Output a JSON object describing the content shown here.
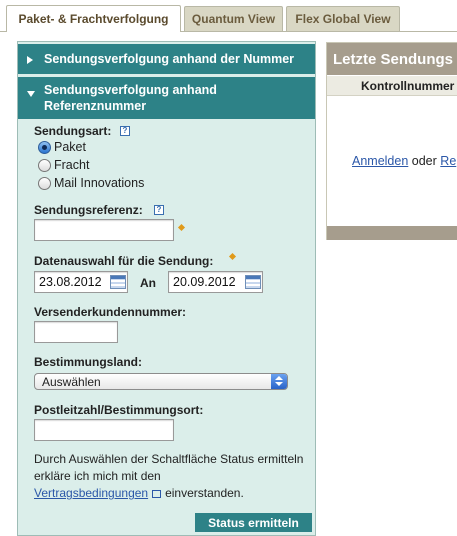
{
  "tabs": [
    {
      "label": "Paket- & Frachtverfolgung",
      "active": true
    },
    {
      "label": "Quantum View",
      "active": false
    },
    {
      "label": "Flex Global View",
      "active": false
    }
  ],
  "sections": {
    "by_number": "Sendungsverfolgung anhand der Nummer",
    "by_reference": "Sendungsverfolgung anhand Referenznummer"
  },
  "form": {
    "shipment_type": {
      "label": "Sendungsart:",
      "options": [
        "Paket",
        "Fracht",
        "Mail Innovations"
      ],
      "selected": "Paket"
    },
    "reference": {
      "label": "Sendungsreferenz:",
      "value": ""
    },
    "date_range": {
      "label": "Datenauswahl für die Sendung:",
      "from": "23.08.2012",
      "to_label": "An",
      "to": "20.09.2012"
    },
    "shipper_number": {
      "label": "Versenderkundennummer:",
      "value": ""
    },
    "destination_country": {
      "label": "Bestimmungsland:",
      "selected": "Auswählen"
    },
    "postal_code": {
      "label": "Postleitzahl/Bestimmungsort:",
      "value": ""
    },
    "terms_text_before": "Durch Auswählen der Schaltfläche Status ermitteln erkläre ich mich mit den",
    "terms_link": "Vertragsbedingungen",
    "terms_text_after": "einverstanden.",
    "submit_label": "Status ermitteln"
  },
  "recent": {
    "title": "Letzte Sendungs",
    "column": "Kontrollnummer",
    "login_link": "Anmelden",
    "or_text": "oder",
    "register_link": "Re"
  },
  "colors": {
    "teal": "#2d8287",
    "panel_bg": "#dbeeea",
    "taupe": "#a69d8d",
    "link": "#2b57a8"
  }
}
